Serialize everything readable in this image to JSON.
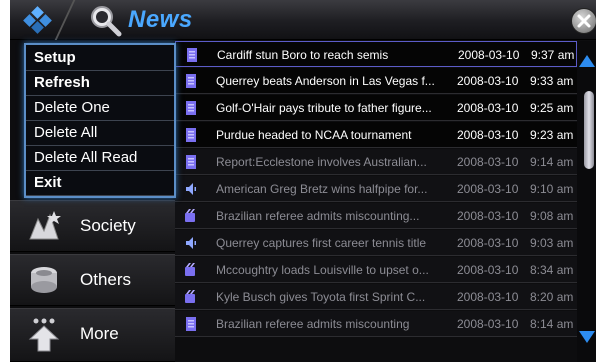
{
  "header": {
    "title": "News",
    "menu_icon": "app-menu-icon",
    "search_icon": "search-icon",
    "close_icon": "close-icon",
    "accent_color": "#4aa8ff"
  },
  "menu": {
    "items": [
      {
        "label": "Setup",
        "bold": true
      },
      {
        "label": "Refresh",
        "bold": true
      },
      {
        "label": "Delete One",
        "bold": false
      },
      {
        "label": "Delete All",
        "bold": false
      },
      {
        "label": "Delete All Read",
        "bold": false
      },
      {
        "label": "Exit",
        "bold": true
      }
    ]
  },
  "sidebar": {
    "categories": [
      {
        "label": "Society",
        "icon": "society-icon"
      },
      {
        "label": "Others",
        "icon": "others-icon"
      },
      {
        "label": "More",
        "icon": "more-icon"
      }
    ]
  },
  "news": {
    "rows": [
      {
        "headline": "Cardiff stun Boro to reach semis",
        "date": "2008-03-10",
        "time": "9:37 am",
        "state": "selected",
        "icon": "article-icon"
      },
      {
        "headline": "Querrey beats Anderson in Las Vegas f...",
        "date": "2008-03-10",
        "time": "9:33 am",
        "state": "unread",
        "icon": "article-icon"
      },
      {
        "headline": "Golf-O'Hair pays tribute to father figure...",
        "date": "2008-03-10",
        "time": "9:25 am",
        "state": "unread",
        "icon": "article-icon"
      },
      {
        "headline": "Purdue headed to NCAA tournament",
        "date": "2008-03-10",
        "time": "9:23 am",
        "state": "unread",
        "icon": "article-icon"
      },
      {
        "headline": "Report:Ecclestone involves Australian...",
        "date": "2008-03-10",
        "time": "9:14 am",
        "state": "read",
        "icon": "article-icon"
      },
      {
        "headline": "American Greg Bretz wins halfpipe for...",
        "date": "2008-03-10",
        "time": "9:10 am",
        "state": "read",
        "icon": "audio-icon"
      },
      {
        "headline": "Brazilian referee admits miscounting...",
        "date": "2008-03-10",
        "time": "9:08 am",
        "state": "read",
        "icon": "video-icon"
      },
      {
        "headline": "Querrey captures first career tennis title",
        "date": "2008-03-10",
        "time": "9:03 am",
        "state": "read",
        "icon": "audio-icon"
      },
      {
        "headline": "Mccoughtry loads Louisville to upset o...",
        "date": "2008-03-10",
        "time": "8:34 am",
        "state": "read",
        "icon": "video-icon"
      },
      {
        "headline": "Kyle Busch gives Toyota first Sprint C...",
        "date": "2008-03-10",
        "time": "8:20 am",
        "state": "read",
        "icon": "video-icon"
      },
      {
        "headline": "Brazilian referee admits miscounting",
        "date": "2008-03-10",
        "time": "8:14 am",
        "state": "read",
        "icon": "article-icon"
      }
    ]
  }
}
